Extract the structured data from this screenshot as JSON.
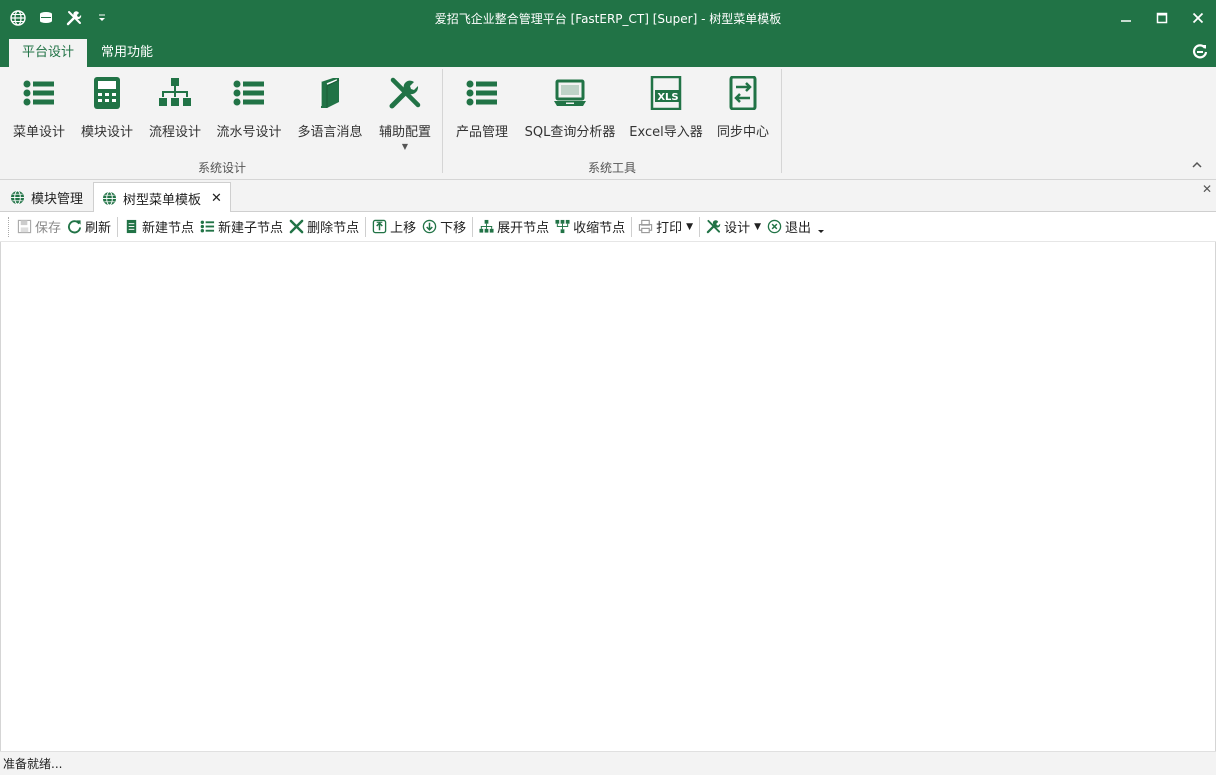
{
  "window": {
    "title": "爱招飞企业整合管理平台 [FastERP_CT] [Super] - 树型菜单模板"
  },
  "quick_access": {
    "icons": [
      "globe-icon",
      "database-icon",
      "tools-icon",
      "customize-dropdown-icon"
    ]
  },
  "ribbon": {
    "tabs": [
      {
        "label": "平台设计",
        "active": true
      },
      {
        "label": "常用功能",
        "active": false
      }
    ],
    "groups": [
      {
        "label": "系统设计",
        "buttons": [
          {
            "label": "菜单设计",
            "icon": "list-icon"
          },
          {
            "label": "模块设计",
            "icon": "calculator-icon"
          },
          {
            "label": "流程设计",
            "icon": "hierarchy-icon"
          },
          {
            "label": "流水号设计",
            "icon": "list-icon"
          },
          {
            "label": "多语言消息",
            "icon": "book-icon"
          },
          {
            "label": "辅助配置",
            "icon": "tools-icon"
          }
        ]
      },
      {
        "label": "系统工具",
        "buttons": [
          {
            "label": "产品管理",
            "icon": "list-icon"
          },
          {
            "label": "SQL查询分析器",
            "icon": "laptop-icon"
          },
          {
            "label": "Excel导入器",
            "icon": "xls-icon"
          },
          {
            "label": "同步中心",
            "icon": "sync-icon"
          }
        ]
      }
    ]
  },
  "document_tabs": [
    {
      "label": "模块管理",
      "active": false
    },
    {
      "label": "树型菜单模板",
      "active": true
    }
  ],
  "toolbar": {
    "save": "保存",
    "refresh": "刷新",
    "new_node": "新建节点",
    "new_child_node": "新建子节点",
    "delete_node": "删除节点",
    "move_up": "上移",
    "move_down": "下移",
    "expand_node": "展开节点",
    "collapse_node": "收缩节点",
    "print": "打印",
    "design": "设计",
    "exit": "退出"
  },
  "status": {
    "text": "准备就绪..."
  },
  "colors": {
    "accent": "#217346",
    "ribbon_bg": "#f3f3f3"
  }
}
